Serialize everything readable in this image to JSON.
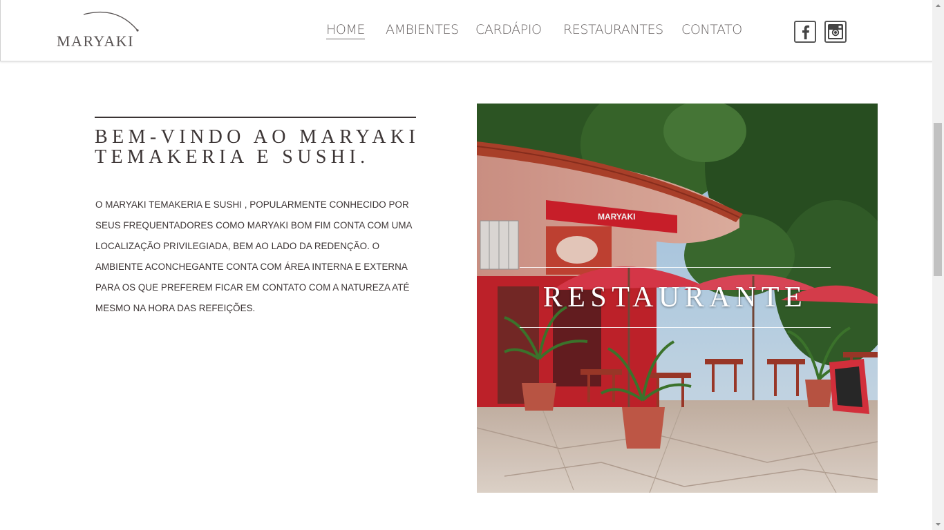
{
  "header": {
    "logo_text": "MARYAKI",
    "nav": [
      {
        "label": "HOME",
        "active": true
      },
      {
        "label": "AMBIENTES",
        "active": false
      },
      {
        "label": "CARDÁPIO",
        "active": false
      },
      {
        "label": "RESTAURANTES",
        "active": false
      },
      {
        "label": "CONTATO",
        "active": false
      }
    ],
    "social": [
      {
        "name": "facebook-icon"
      },
      {
        "name": "instagram-icon"
      }
    ]
  },
  "main": {
    "title_line1": "BEM-VINDO AO MARYAKI",
    "title_line2": "TEMAKERIA E SUSHI.",
    "description_lines": [
      "O MARYAKI TEMAKERIA E SUSHI , POPULARMENTE CONHECIDO POR",
      "SEUS FREQUENTADORES COMO MARYAKI BOM FIM CONTA COM UMA",
      "LOCALIZAÇÃO PRIVILEGIADA, BEM AO LADO DA REDENÇÃO. O",
      "AMBIENTE ACONCHEGANTE CONTA COM ÁREA INTERNA E EXTERNA",
      "PARA OS QUE PREFEREM FICAR EM CONTATO COM A NATUREZA ATÉ",
      "MESMO NA HORA DAS REFEIÇÕES."
    ],
    "photo_label": "RESTAURANTE",
    "photo_sign_text": "MARYAKI"
  },
  "colors": {
    "text": "#3d3636",
    "nav": "#6b6666",
    "accent_red": "#d4202c"
  }
}
